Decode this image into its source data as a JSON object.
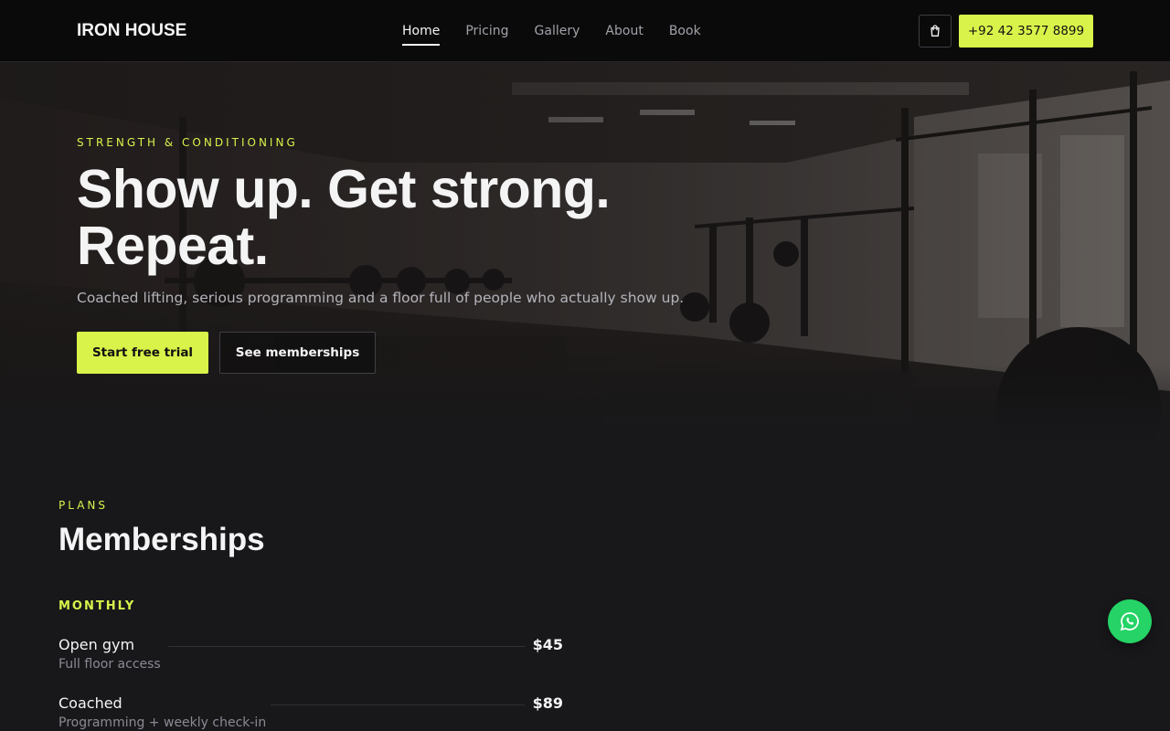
{
  "brand": {
    "logo": "IRON HOUSE"
  },
  "nav": {
    "links": [
      "Home",
      "Pricing",
      "Gallery",
      "About",
      "Book"
    ],
    "active": "Home",
    "cart_icon": "shopping-bag-icon",
    "phone": "+92 42 3577 8899"
  },
  "hero": {
    "eyebrow": "STRENGTH & CONDITIONING",
    "title": "Show up. Get strong. Repeat.",
    "subtitle": "Coached lifting, serious programming and a floor full of people who actually show up.",
    "primary_cta": "Start free trial",
    "secondary_cta": "See memberships"
  },
  "memberships": {
    "eyebrow": "PLANS",
    "title": "Memberships",
    "group": "MONTHLY",
    "plans": [
      {
        "name": "Open gym",
        "desc": "Full floor access",
        "price": "$45"
      },
      {
        "name": "Coached",
        "desc": "Programming + weekly check-in",
        "price": "$89"
      }
    ]
  },
  "floating": {
    "whatsapp_icon": "whatsapp-icon"
  },
  "colors": {
    "accent": "#d9f34a",
    "background": "#18181b",
    "nav_bg": "#0a0a0a",
    "whatsapp": "#25d366"
  }
}
